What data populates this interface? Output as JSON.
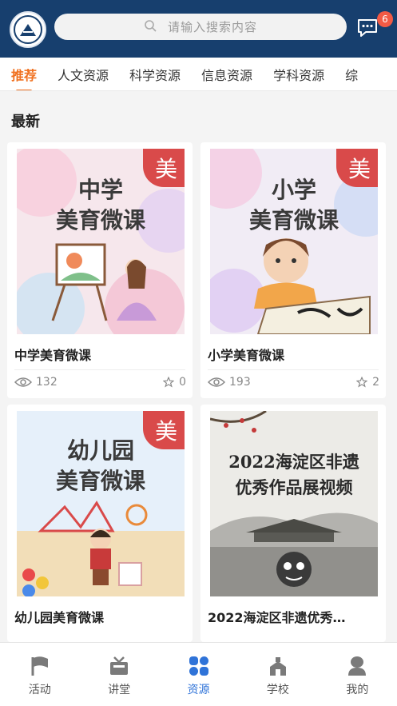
{
  "header": {
    "search_placeholder": "请输入搜索内容",
    "message_count": "6"
  },
  "tabs": [
    {
      "label": "推荐",
      "active": true
    },
    {
      "label": "人文资源"
    },
    {
      "label": "科学资源"
    },
    {
      "label": "信息资源"
    },
    {
      "label": "学科资源"
    },
    {
      "label": "综"
    }
  ],
  "section": {
    "title": "最新"
  },
  "cards": [
    {
      "title": "中学美育微课",
      "views": "132",
      "stars": "0",
      "ribbon": "美",
      "poster_lines": [
        "中学",
        "美育微课"
      ],
      "colors": {
        "bg": "#f6e7ec",
        "accent": "#e96a9a"
      }
    },
    {
      "title": "小学美育微课",
      "views": "193",
      "stars": "2",
      "ribbon": "美",
      "poster_lines": [
        "小学",
        "美育微课"
      ],
      "colors": {
        "bg": "#f1ecf5",
        "accent": "#9c6bd6"
      }
    },
    {
      "title": "幼儿园美育微课",
      "views": "",
      "stars": "",
      "ribbon": "美",
      "poster_lines": [
        "幼儿园",
        "美育微课"
      ],
      "colors": {
        "bg": "#e6f0fa",
        "accent": "#6aaee8"
      }
    },
    {
      "title": "2022海淀区非遗优秀…",
      "views": "",
      "stars": "",
      "poster_lines": [
        "2022海淀区非遗",
        "优秀作品展视频"
      ],
      "colors": {
        "bg": "#ecebe7",
        "accent": "#8b8b86"
      }
    }
  ],
  "bottom_nav": [
    {
      "label": "活动",
      "icon": "flag-icon"
    },
    {
      "label": "讲堂",
      "icon": "classroom-icon"
    },
    {
      "label": "资源",
      "icon": "grid-icon",
      "active": true
    },
    {
      "label": "学校",
      "icon": "school-icon"
    },
    {
      "label": "我的",
      "icon": "user-icon"
    }
  ],
  "colors": {
    "header": "#173f6e",
    "accent_tab": "#f0701f",
    "active_nav": "#2f73d8",
    "ribbon": "#d94a4a"
  }
}
